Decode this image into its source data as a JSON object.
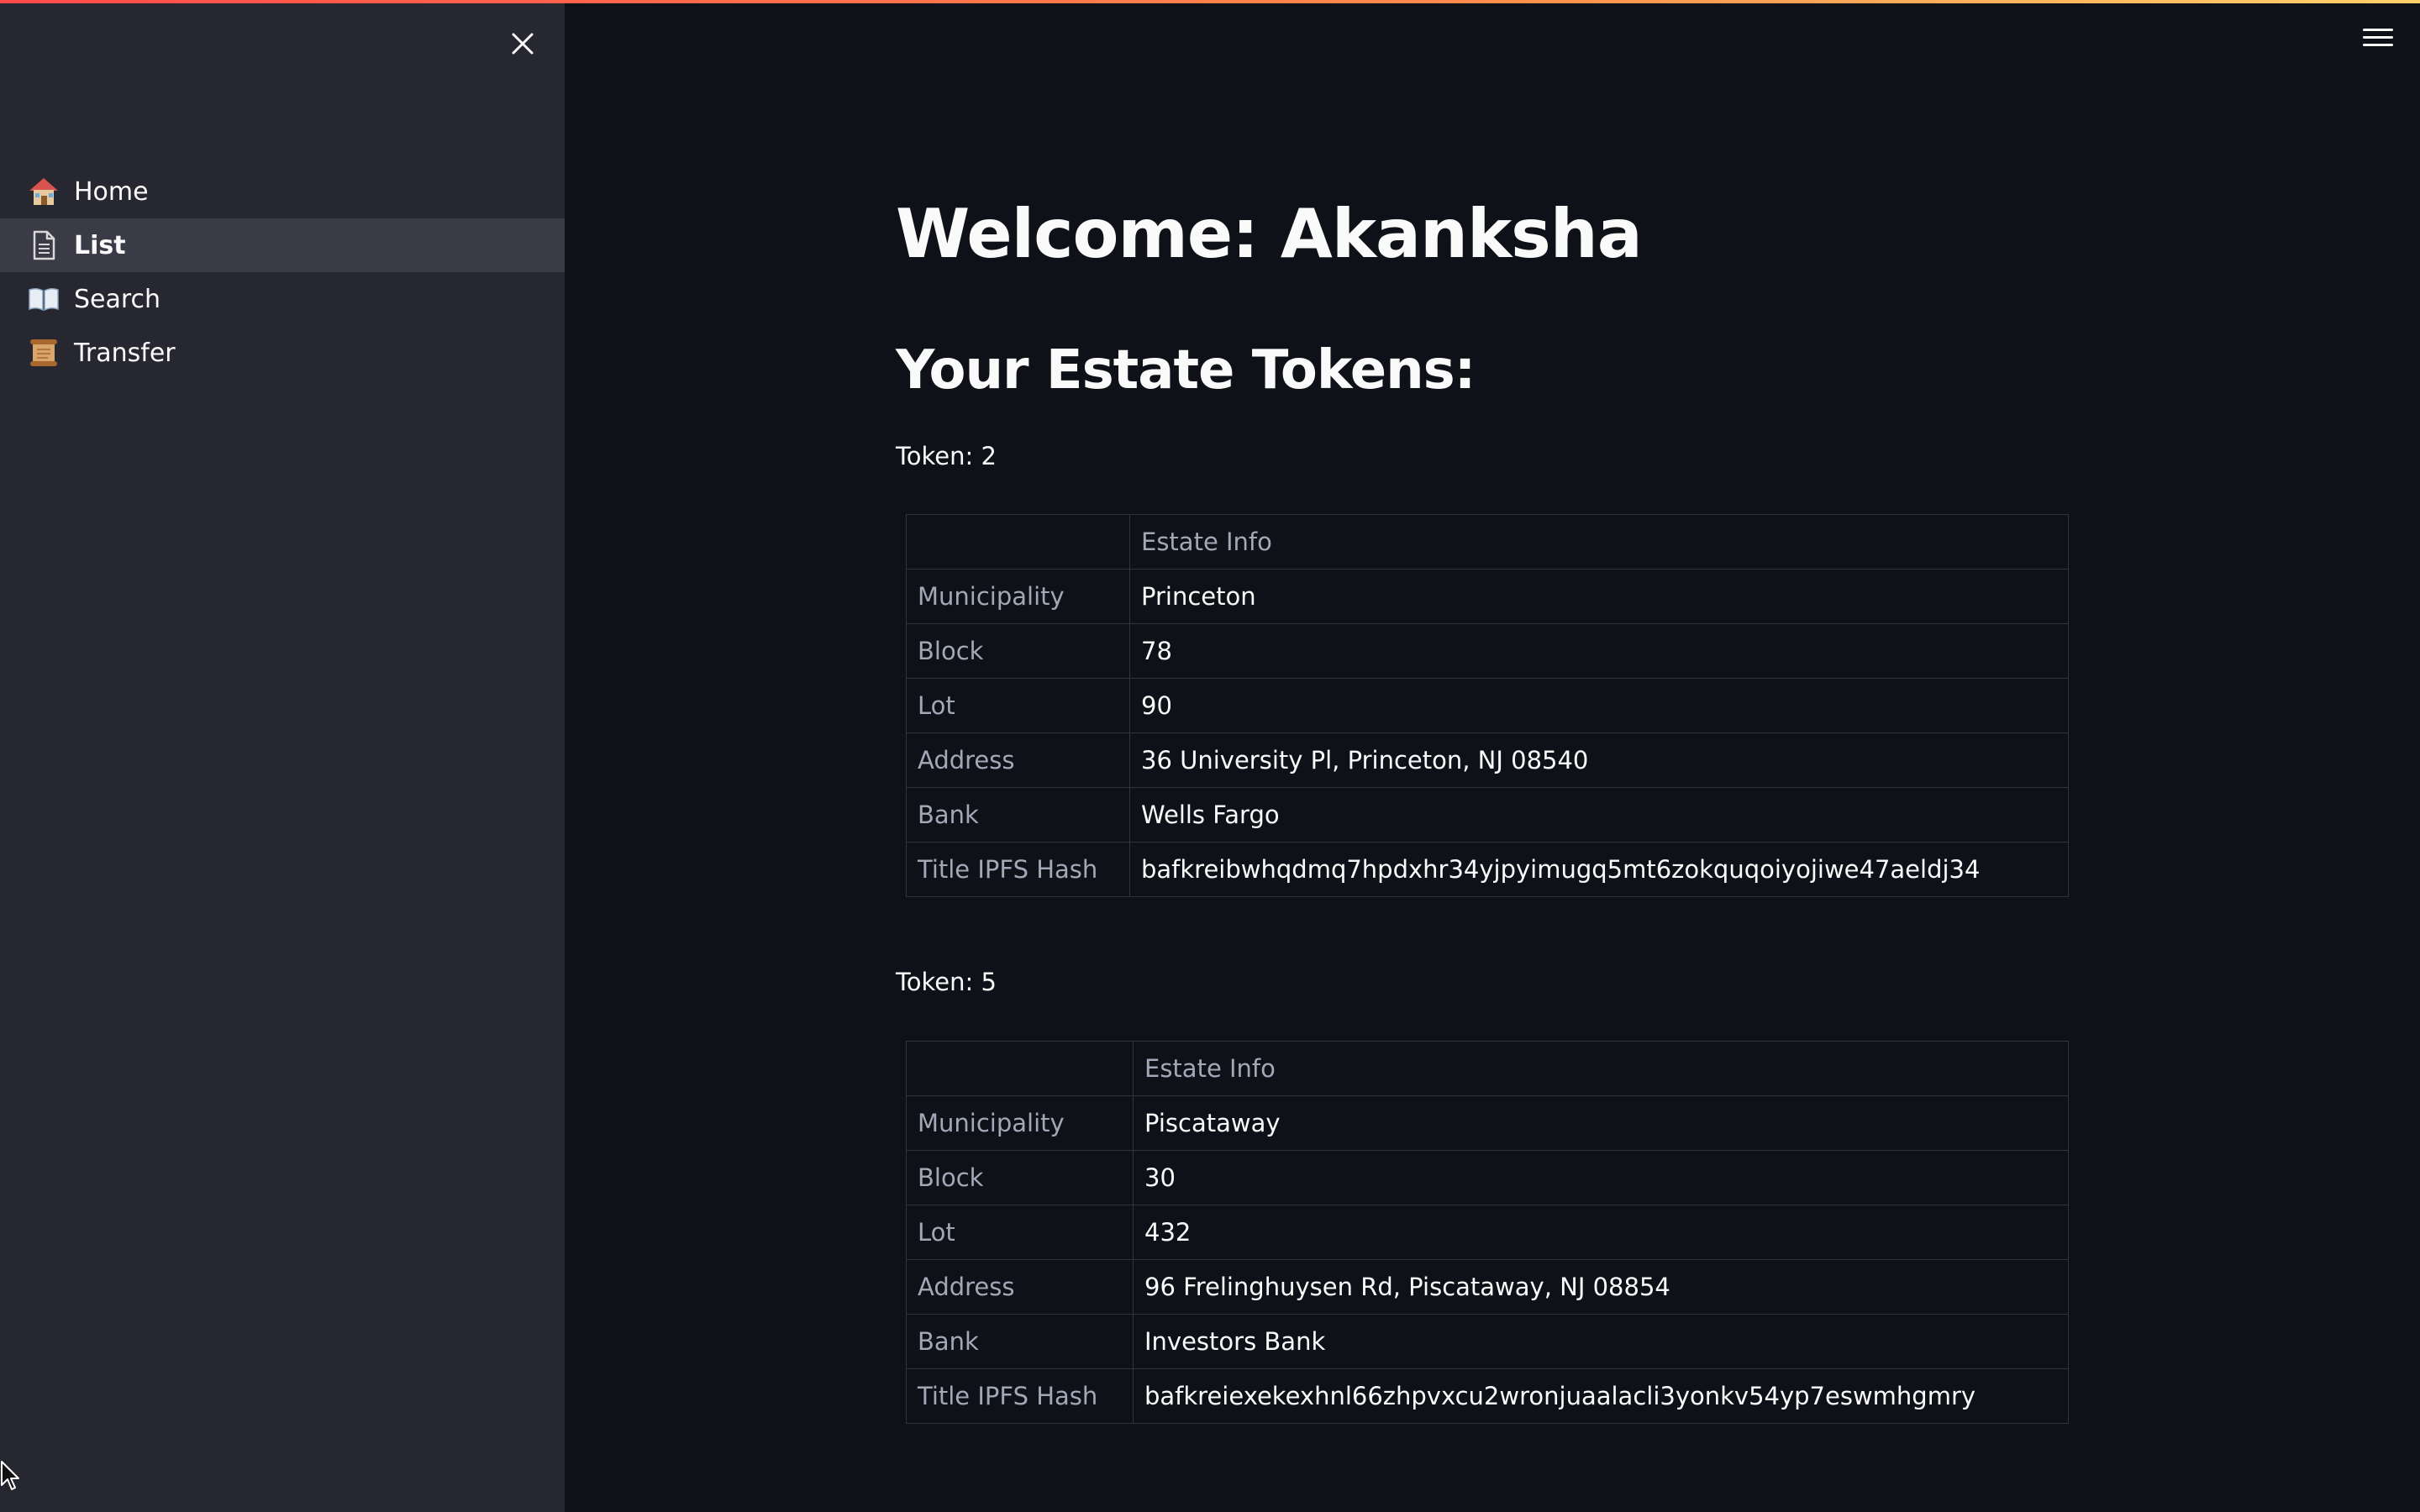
{
  "sidebar": {
    "close_icon": "close-icon",
    "items": [
      {
        "label": "Home",
        "icon": "house-icon",
        "active": false
      },
      {
        "label": "List",
        "icon": "document-icon",
        "active": true
      },
      {
        "label": "Search",
        "icon": "open-book-icon",
        "active": false
      },
      {
        "label": "Transfer",
        "icon": "scroll-icon",
        "active": false
      }
    ]
  },
  "header": {
    "menu_icon": "hamburger-menu-icon"
  },
  "main": {
    "welcome": "Welcome: Akanksha",
    "tokens_heading": "Your Estate Tokens:",
    "tokens": [
      {
        "label": "Token: 2",
        "column_header": "Estate Info",
        "rows": [
          {
            "field": "Municipality",
            "value": "Princeton"
          },
          {
            "field": "Block",
            "value": "78"
          },
          {
            "field": "Lot",
            "value": "90"
          },
          {
            "field": "Address",
            "value": "36 University Pl, Princeton, NJ 08540"
          },
          {
            "field": "Bank",
            "value": "Wells Fargo"
          },
          {
            "field": "Title IPFS Hash",
            "value": "bafkreibwhqdmq7hpdxhr34yjpyimugq5mt6zokquqoiyojiwe47aeldj34"
          }
        ]
      },
      {
        "label": "Token: 5",
        "column_header": "Estate Info",
        "rows": [
          {
            "field": "Municipality",
            "value": "Piscataway"
          },
          {
            "field": "Block",
            "value": "30"
          },
          {
            "field": "Lot",
            "value": "432"
          },
          {
            "field": "Address",
            "value": "96 Frelinghuysen Rd, Piscataway, NJ 08854"
          },
          {
            "field": "Bank",
            "value": "Investors Bank"
          },
          {
            "field": "Title IPFS Hash",
            "value": "bafkreiexekexhnl66zhpvxcu2wronjuaalacli3yonkv54yp7eswmhgmry"
          }
        ]
      }
    ]
  },
  "colors": {
    "background": "#0e1117",
    "sidebar": "#262730",
    "active_item": "#3a3b46",
    "text": "#fafafa",
    "muted_text": "#a3a8b8",
    "border": "#31333f",
    "accent": "#ff4b4b"
  }
}
